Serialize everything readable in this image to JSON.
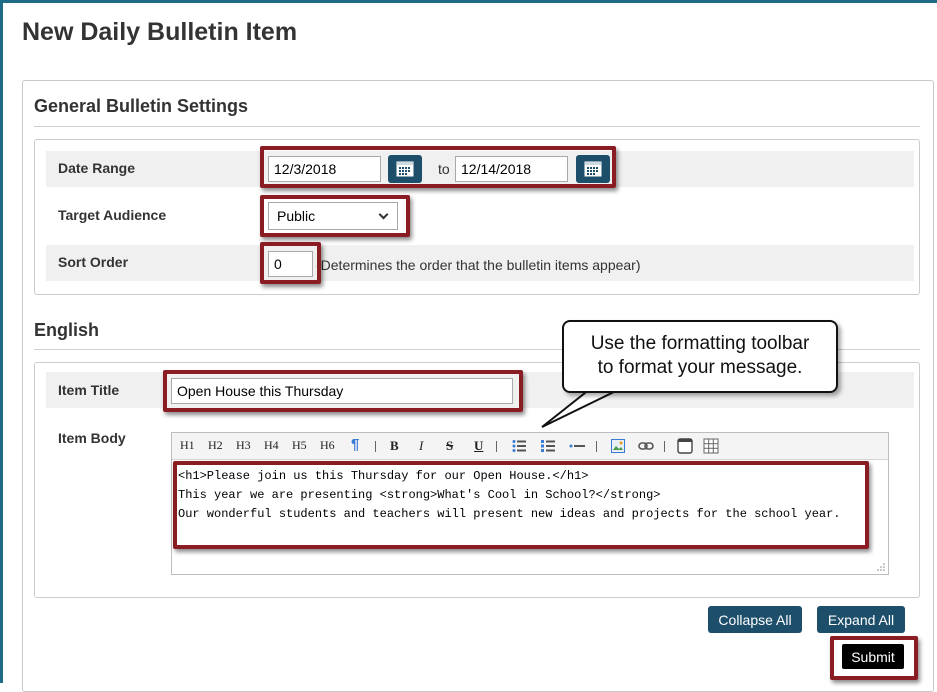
{
  "page": {
    "title": "New Daily Bulletin Item"
  },
  "general": {
    "heading": "General Bulletin Settings",
    "date_range": {
      "label": "Date Range",
      "from": "12/3/2018",
      "to_label": "to",
      "to": "12/14/2018"
    },
    "target_audience": {
      "label": "Target Audience",
      "selected": "Public"
    },
    "sort_order": {
      "label": "Sort Order",
      "value": "0",
      "hint": "(Determines the order that the bulletin items appear)"
    }
  },
  "english": {
    "heading": "English",
    "item_title": {
      "label": "Item Title",
      "value": "Open House this Thursday"
    },
    "item_body": {
      "label": "Item Body",
      "toolbar": {
        "h1": "H1",
        "h2": "H2",
        "h3": "H3",
        "h4": "H4",
        "h5": "H5",
        "h6": "H6",
        "bold": "B",
        "italic": "I",
        "strike": "S",
        "underline": "U"
      },
      "lines": [
        "<h1>Please join us this Thursday for our Open House.</h1>",
        "This year we are presenting <strong>What's Cool in School?</strong>",
        "Our wonderful students and teachers will present new ideas and projects for the school year."
      ]
    }
  },
  "callout": {
    "line1": "Use the formatting toolbar",
    "line2": "to format your message."
  },
  "buttons": {
    "collapse_all": "Collapse All",
    "expand_all": "Expand All",
    "submit": "Submit"
  },
  "colors": {
    "accent": "#1d4f6b",
    "highlight": "#8a1c24",
    "frame": "#1f6b86"
  }
}
